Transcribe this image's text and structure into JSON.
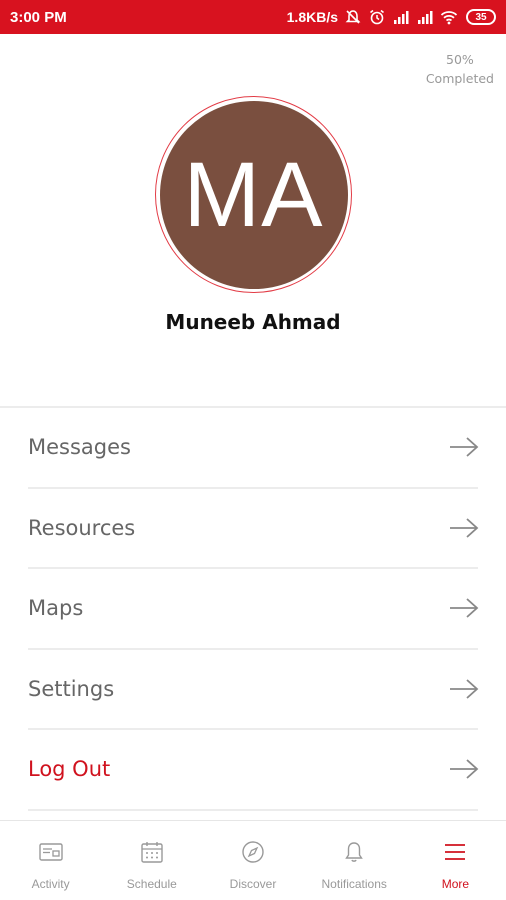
{
  "status_bar": {
    "time": "3:00 PM",
    "speed": "1.8KB/s",
    "battery": "35",
    "icons": [
      "mute-icon",
      "alarm-icon",
      "signal-icon",
      "signal-icon",
      "wifi-icon",
      "battery-icon"
    ]
  },
  "progress": {
    "percent": "50%",
    "label": "Completed",
    "value": 0.5
  },
  "profile": {
    "initials": "MA",
    "name": "Muneeb Ahmad",
    "avatar_color": "#7a4f3f",
    "ring_color": "#e23b45"
  },
  "menu": {
    "items": [
      {
        "label": "Messages",
        "icon": "arrow-right-icon"
      },
      {
        "label": "Resources",
        "icon": "arrow-right-icon"
      },
      {
        "label": "Maps",
        "icon": "arrow-right-icon"
      },
      {
        "label": "Settings",
        "icon": "arrow-right-icon"
      },
      {
        "label": "Log Out",
        "icon": "arrow-right-icon",
        "color": "#d0121e"
      }
    ]
  },
  "bottom_nav": {
    "items": [
      {
        "label": "Activity",
        "icon": "activity-icon"
      },
      {
        "label": "Schedule",
        "icon": "calendar-icon"
      },
      {
        "label": "Discover",
        "icon": "compass-icon"
      },
      {
        "label": "Notifications",
        "icon": "bell-icon"
      },
      {
        "label": "More",
        "icon": "menu-icon",
        "active": true
      }
    ],
    "active_color": "#d0121e",
    "inactive_color": "#999999"
  },
  "colors": {
    "status_bar": "#d8121f",
    "accent": "#d0121e"
  }
}
